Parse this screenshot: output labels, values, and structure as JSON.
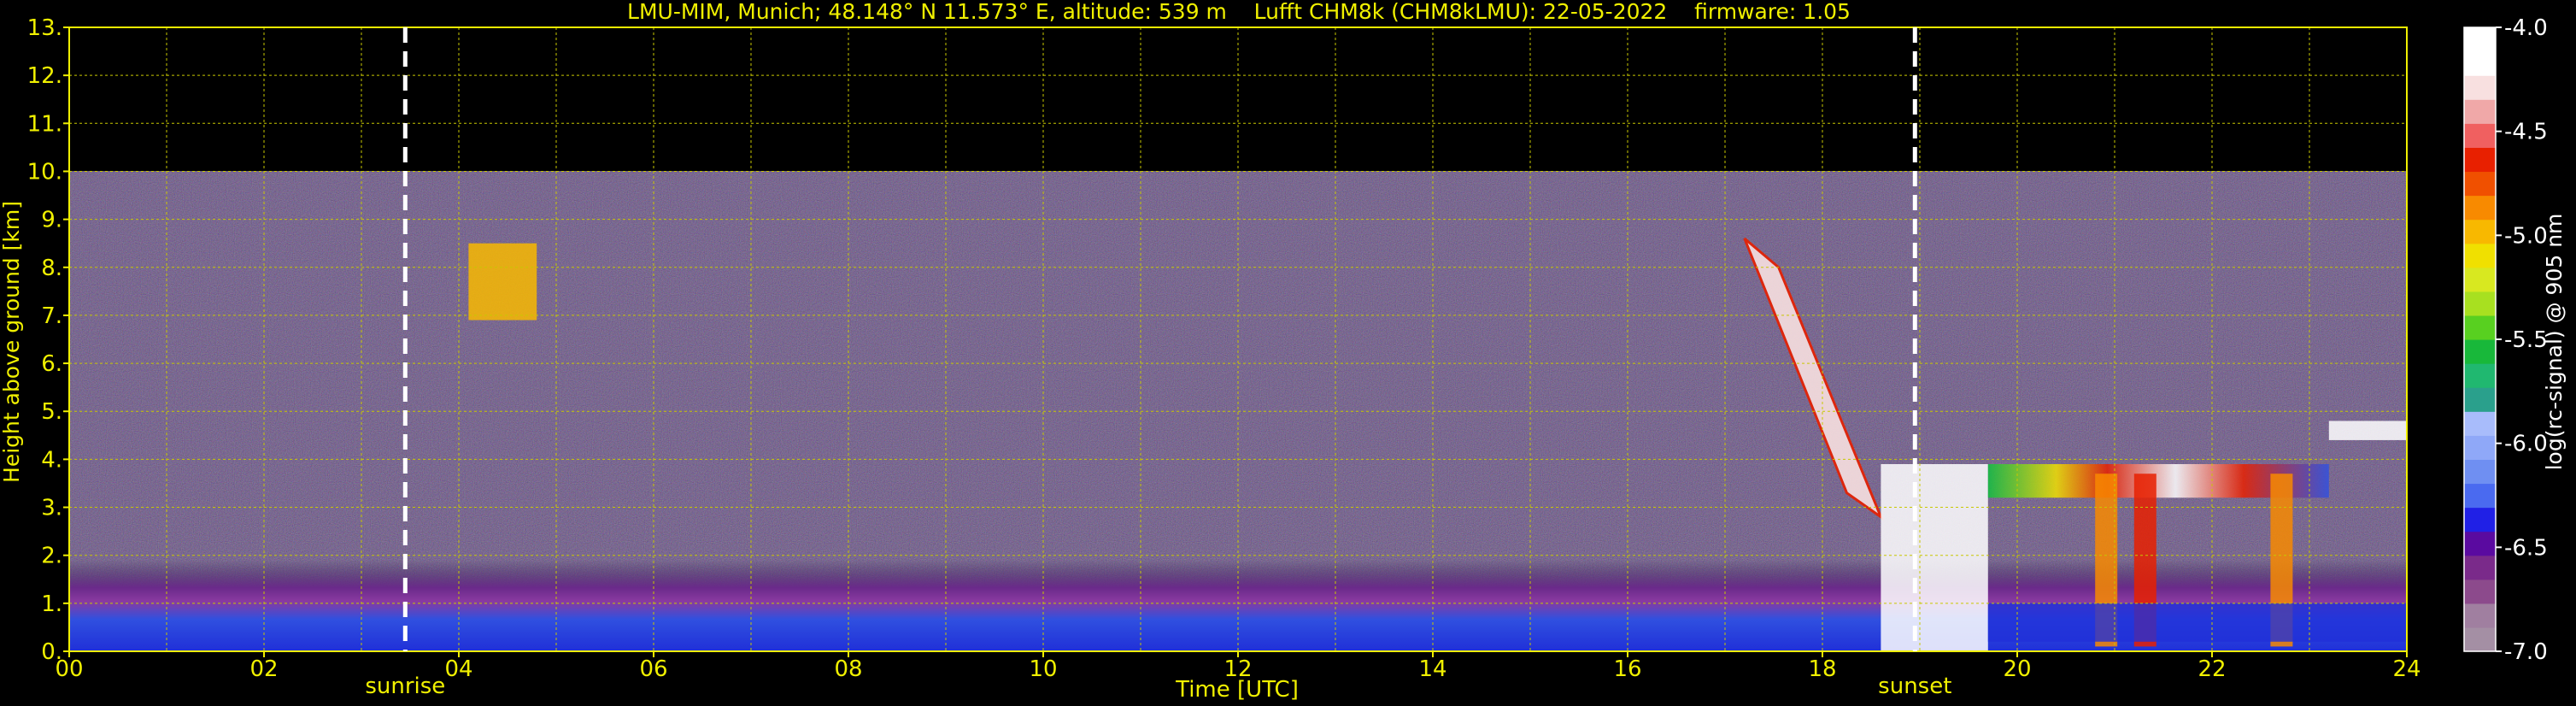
{
  "chart_data": {
    "type": "heatmap",
    "title": "LMU-MIM, Munich; 48.148° N 11.573° E, altitude: 539 m    Lufft CHM8k (CHM8kLMU): 22-05-2022    firmware: 1.05",
    "xlabel": "Time [UTC]",
    "ylabel": "Height above ground [km]",
    "x_ticks": [
      "00",
      "02",
      "04",
      "06",
      "08",
      "10",
      "12",
      "14",
      "16",
      "18",
      "20",
      "22",
      "24"
    ],
    "y_ticks": [
      "0.",
      "1.",
      "2.",
      "3.",
      "4.",
      "5.",
      "6.",
      "7.",
      "8.",
      "9.",
      "10.",
      "11.",
      "12.",
      "13."
    ],
    "xlim": [
      0,
      24
    ],
    "ylim": [
      0,
      13
    ],
    "data_top_km": 10,
    "grid": true,
    "grid_color": "#c8c800",
    "text_color": "#f0f000",
    "markers": [
      {
        "label": "sunrise",
        "time_utc": 3.45
      },
      {
        "label": "sunset",
        "time_utc": 18.95
      }
    ],
    "colorbar": {
      "label": "log(rc-signal) @ 905 nm",
      "ticks": [
        "-4.0",
        "-4.5",
        "-5.0",
        "-5.5",
        "-6.0",
        "-6.5",
        "-7.0"
      ],
      "range": [
        -7.0,
        -4.0
      ],
      "colors": [
        "#a48fa4",
        "#a07fa0",
        "#8c4a8c",
        "#7a2a8a",
        "#5a0aa0",
        "#2020e6",
        "#4a6af0",
        "#6f8ff2",
        "#8fa8f8",
        "#a8bcfb",
        "#2aa08c",
        "#20b870",
        "#18b83a",
        "#58d020",
        "#a8e020",
        "#d8e820",
        "#f0e000",
        "#f8b800",
        "#f88a00",
        "#f05000",
        "#e82000",
        "#f06060",
        "#f0a8a8",
        "#f8e0e0",
        "#ffffff",
        "#ffffff"
      ]
    },
    "features": [
      {
        "name": "boundary layer / aerosol",
        "t_start": 0,
        "t_end": 24,
        "h_bottom_km": 0.0,
        "h_top_km": 1.9,
        "level": -6.4
      },
      {
        "name": "cirrus",
        "t_start": 4.1,
        "t_end": 4.8,
        "h_bottom_km": 6.9,
        "h_top_km": 8.5,
        "level": -5.0
      },
      {
        "name": "descending cloud",
        "t_start": 17.2,
        "t_end": 18.6,
        "h_bottom_km": 2.8,
        "h_top_km": 8.6,
        "level": -4.2
      },
      {
        "name": "evening cloud",
        "t_start": 18.6,
        "t_end": 19.7,
        "h_bottom_km": 0.0,
        "h_top_km": 3.9,
        "level": -4.1
      },
      {
        "name": "broken cloud layer",
        "t_start": 19.7,
        "t_end": 23.2,
        "h_bottom_km": 0.3,
        "h_top_km": 4.0,
        "level": -4.6
      },
      {
        "name": "elevated layer",
        "t_start": 23.2,
        "t_end": 24,
        "h_bottom_km": 4.4,
        "h_top_km": 4.8,
        "level": -4.1
      }
    ]
  }
}
